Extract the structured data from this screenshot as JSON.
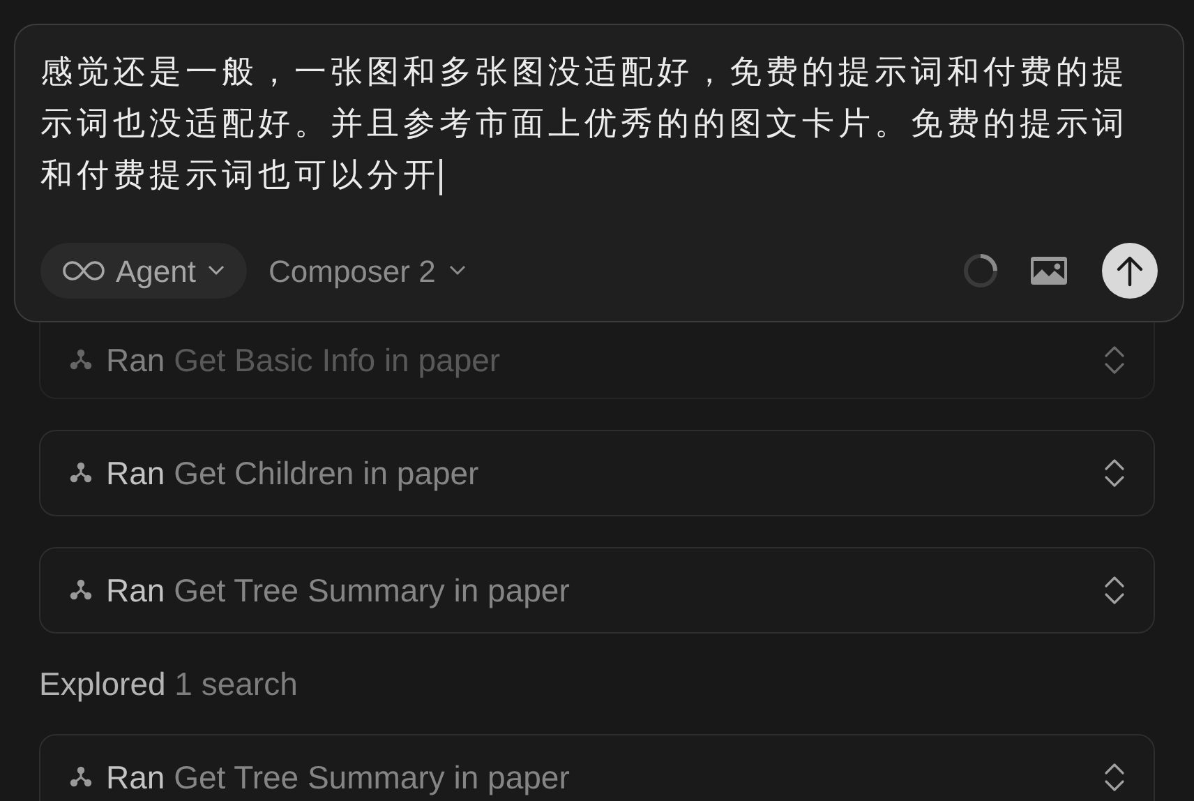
{
  "composer": {
    "text": "感觉还是一般，一张图和多张图没适配好，免费的提示词和付费的提示词也没适配好。并且参考市面上优秀的的图文卡片。免费的提示词和付费提示词也可以分开",
    "mode": "Agent",
    "model": "Composer 2"
  },
  "activity": [
    {
      "kind": "tool",
      "verb": "Ran",
      "detail": "Get Basic Info in paper",
      "faded": true
    },
    {
      "kind": "tool",
      "verb": "Ran",
      "detail": "Get Children in paper",
      "faded": false
    },
    {
      "kind": "tool",
      "verb": "Ran",
      "detail": "Get Tree Summary in paper",
      "faded": false
    },
    {
      "kind": "summary",
      "verb": "Explored",
      "detail": "1 search"
    },
    {
      "kind": "tool",
      "verb": "Ran",
      "detail": "Get Tree Summary in paper",
      "faded": false
    }
  ]
}
